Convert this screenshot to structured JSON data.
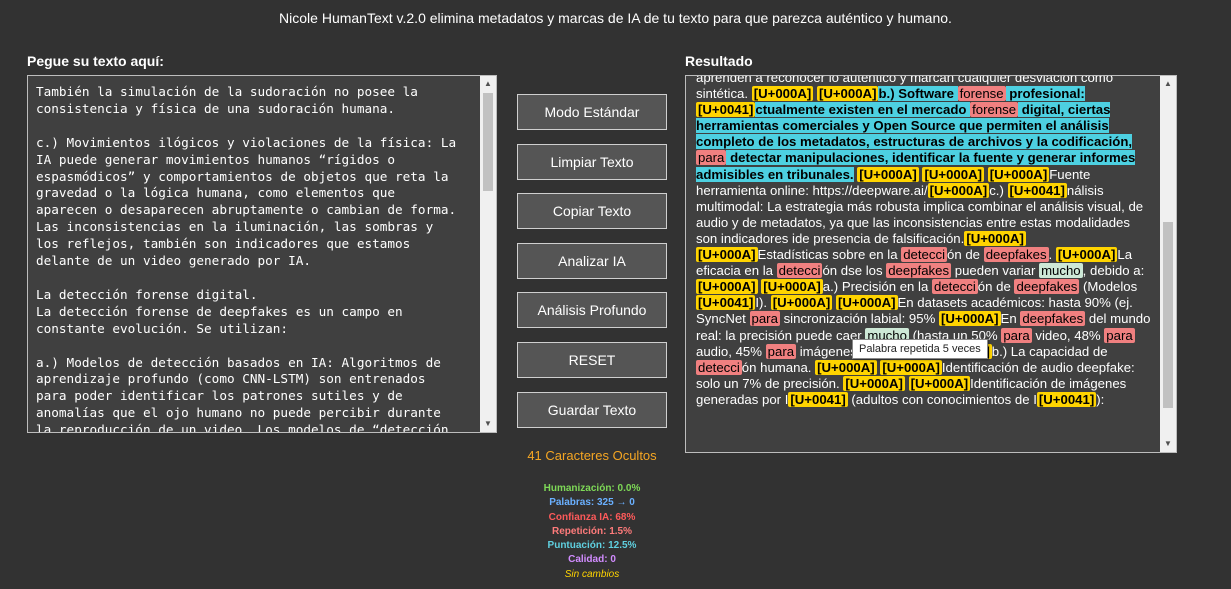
{
  "header": {
    "title": "Nicole HumanText v.2.0 elimina metadatos y marcas de IA de tu texto para que parezca auténtico y humano."
  },
  "input_panel": {
    "label": "Pegue su texto aquí:",
    "text": "También la simulación de la sudoración no posee la\nconsistencia y física de una sudoración humana.\n\nc.) Movimientos ilógicos y violaciones de la física: La\nIA puede generar movimientos humanos “rígidos o\nespasmódicos” y comportamientos de objetos que reta la\ngravedad o la lógica humana, como elementos que\naparecen o desaparecen abruptamente o cambian de forma.\nLas inconsistencias en la iluminación, las sombras y\nlos reflejos, también son indicadores que estamos\ndelante de un video generado por IA.\n\nLa detección forense digital.\nLa detección forense de deepfakes es un campo en\nconstante evolución. Se utilizan:\n\na.) Modelos de detección basados en IA: Algoritmos de\naprendizaje profundo (como CNN-LSTM) son entrenados\npara poder identificar los patrones sutiles y de\nanomalías que el ojo humano no puede percibir durante\nla reproducción de un video. Los modelos de “detección"
  },
  "buttons": {
    "standard": "Modo Estándar",
    "clear": "Limpiar Texto",
    "copy": "Copiar Texto",
    "analyze": "Analizar IA",
    "deep": "Análisis Profundo",
    "reset": "RESET",
    "save": "Guardar Texto"
  },
  "hidden_chars": "41 Caracteres Ocultos",
  "stats": {
    "humanization": "Humanización: 0.0%",
    "words": "Palabras: 325 → 0",
    "ai_confidence": "Confianza IA: 68%",
    "repetition": "Repetición: 1.5%",
    "punctuation": "Puntuación: 12.5%",
    "quality": "Calidad: 0",
    "changes": "Sin cambios"
  },
  "stat_colors": {
    "humanization": "#7ed957",
    "words": "#6ab0ff",
    "ai_confidence": "#ff5a5a",
    "repetition": "#ff7b7b",
    "punctuation": "#5fd0e0",
    "quality": "#d28cff",
    "changes": "#ffd400"
  },
  "result_panel": {
    "label": "Resultado",
    "tooltip": "Palabra repetida 5 veces",
    "segments": [
      {
        "t": "aprenden a reconocer lo auténtico y marcan cualquier desviación como sintética. ",
        "k": ""
      },
      {
        "t": "[U+000A]",
        "k": "u"
      },
      {
        "t": " ",
        "k": ""
      },
      {
        "t": "[U+000A]",
        "k": "u"
      },
      {
        "t": "b.) Software ",
        "k": "c"
      },
      {
        "t": "forense",
        "k": "r"
      },
      {
        "t": " profesional: ",
        "k": "c"
      },
      {
        "t": "[U+0041]",
        "k": "u"
      },
      {
        "t": "ctualmente existen en el mercado ",
        "k": "c"
      },
      {
        "t": "forense",
        "k": "r"
      },
      {
        "t": " digital, ciertas herramientas comerciales y Open Source que permiten el análisis completo de los metadatos, estructuras de archivos y la codificación, ",
        "k": "c"
      },
      {
        "t": "para",
        "k": "r"
      },
      {
        "t": " detectar manipulaciones, identificar la fuente y generar informes admisibles en tribunales.",
        "k": "c"
      },
      {
        "t": " ",
        "k": ""
      },
      {
        "t": "[U+000A]",
        "k": "u"
      },
      {
        "t": " ",
        "k": ""
      },
      {
        "t": "[U+000A]",
        "k": "u"
      },
      {
        "t": " ",
        "k": ""
      },
      {
        "t": "[U+000A]",
        "k": "u"
      },
      {
        "t": "Fuente herramienta online: https://deepware.ai/",
        "k": ""
      },
      {
        "t": "[U+000A]",
        "k": "u"
      },
      {
        "t": "c.) ",
        "k": ""
      },
      {
        "t": "[U+0041]",
        "k": "u"
      },
      {
        "t": "nálisis multimodal: La estrategia más robusta implica combinar el análisis visual, de audio y de metadatos, ya que las inconsistencias entre estas modalidades son indicadores ide presencia de falsificación.",
        "k": ""
      },
      {
        "t": "[U+000A]",
        "k": "u"
      },
      {
        "t": " ",
        "k": ""
      },
      {
        "t": "[U+000A]",
        "k": "u"
      },
      {
        "t": "Estadísticas sobre en la ",
        "k": ""
      },
      {
        "t": "detecci",
        "k": "r"
      },
      {
        "t": "ón de ",
        "k": ""
      },
      {
        "t": "deepfakes",
        "k": "r"
      },
      {
        "t": ". ",
        "k": ""
      },
      {
        "t": "[U+000A]",
        "k": "u"
      },
      {
        "t": "La eficacia en la ",
        "k": ""
      },
      {
        "t": "detecci",
        "k": "r"
      },
      {
        "t": "ón dse los ",
        "k": ""
      },
      {
        "t": "deepfakes",
        "k": "r"
      },
      {
        "t": " pueden variar ",
        "k": ""
      },
      {
        "t": "mucho",
        "k": "g"
      },
      {
        "t": ", debido a:",
        "k": ""
      },
      {
        "t": "[U+000A]",
        "k": "u"
      },
      {
        "t": " ",
        "k": ""
      },
      {
        "t": "[U+000A]",
        "k": "u"
      },
      {
        "t": "a.) Precisión en la ",
        "k": ""
      },
      {
        "t": "detecci",
        "k": "r"
      },
      {
        "t": "ón de ",
        "k": ""
      },
      {
        "t": "deepfakes",
        "k": "r"
      },
      {
        "t": " (Modelos ",
        "k": ""
      },
      {
        "t": "[U+0041]",
        "k": "u"
      },
      {
        "t": "I). ",
        "k": ""
      },
      {
        "t": "[U+000A]",
        "k": "u"
      },
      {
        "t": " ",
        "k": ""
      },
      {
        "t": "[U+000A]",
        "k": "u"
      },
      {
        "t": "En datasets académicos: hasta 90% (ej. SyncNet ",
        "k": ""
      },
      {
        "t": "para",
        "k": "r"
      },
      {
        "t": " sincronización labial: 95% ",
        "k": ""
      },
      {
        "t": "[U+000A]",
        "k": "u"
      },
      {
        "t": "En ",
        "k": ""
      },
      {
        "t": "deepfakes",
        "k": "r"
      },
      {
        "t": " del mundo real: la precisión puede caer ",
        "k": ""
      },
      {
        "t": "mucho",
        "k": "g"
      },
      {
        "t": " (hasta un 50% ",
        "k": ""
      },
      {
        "t": "para",
        "k": "r"
      },
      {
        "t": " video, 48% ",
        "k": ""
      },
      {
        "t": "para",
        "k": "r"
      },
      {
        "t": " audio, 45% ",
        "k": ""
      },
      {
        "t": "para",
        "k": "r"
      },
      {
        "t": " imágenes).",
        "k": ""
      },
      {
        "t": "[U+000A]",
        "k": "u"
      },
      {
        "t": " ",
        "k": ""
      },
      {
        "t": "[U+000A]",
        "k": "u"
      },
      {
        "t": "b.) La capacidad de ",
        "k": ""
      },
      {
        "t": "detecci",
        "k": "r"
      },
      {
        "t": "ón humana. ",
        "k": ""
      },
      {
        "t": "[U+000A]",
        "k": "u"
      },
      {
        "t": " ",
        "k": ""
      },
      {
        "t": "[U+000A]",
        "k": "u"
      },
      {
        "t": "Identificación de audio deepfake: solo un 7% de precisión. ",
        "k": ""
      },
      {
        "t": "[U+000A]",
        "k": "u"
      },
      {
        "t": " ",
        "k": ""
      },
      {
        "t": "[U+000A]",
        "k": "u"
      },
      {
        "t": "Identificación de imágenes generadas por I",
        "k": ""
      },
      {
        "t": "[U+0041]",
        "k": "u"
      },
      {
        "t": " (adultos con conocimientos de I",
        "k": ""
      },
      {
        "t": "[U+0041]",
        "k": "u"
      },
      {
        "t": "):",
        "k": ""
      }
    ]
  }
}
